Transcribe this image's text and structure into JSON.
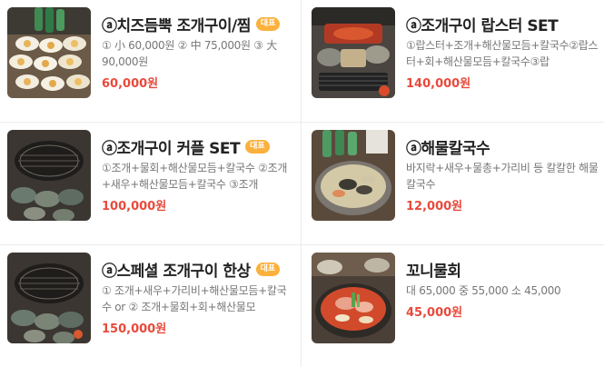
{
  "items": [
    {
      "title": "ⓐ치즈듬뿍 조개구이/찜",
      "badge": "대표",
      "desc": "① 小 60,000원 ② 中 75,000원 ③ 大 90,000원",
      "price": "60,000원",
      "thumb": "cheese-shellfish-photo"
    },
    {
      "title": "ⓐ조개구이 랍스터 SET",
      "badge": "",
      "desc": "①랍스터+조개+해산물모듬+칼국수②랍스터+회+해산물모듬+칼국수③랍",
      "price": "140,000원",
      "thumb": "lobster-set-photo"
    },
    {
      "title": "ⓐ조개구이 커플 SET",
      "badge": "대표",
      "desc": "①조개+물회+해산물모듬+칼국수 ②조개+새우+해산물모듬+칼국수 ③조개",
      "price": "100,000원",
      "thumb": "grill-couple-photo"
    },
    {
      "title": "ⓐ해물칼국수",
      "badge": "",
      "desc": "바지락+새우+물총+가리비 등 칼칼한 해물칼국수",
      "price": "12,000원",
      "thumb": "kalguksu-photo"
    },
    {
      "title": "ⓐ스페셜 조개구이 한상",
      "badge": "대표",
      "desc": "① 조개+새우+가리비+해산물모듬+칼국수 or ② 조개+물회+회+해산물모",
      "price": "150,000원",
      "thumb": "grill-special-photo"
    },
    {
      "title": "꼬니물회",
      "badge": "",
      "desc": "대 65,000 중 55,000 소 45,000",
      "price": "45,000원",
      "thumb": "mulhoe-photo"
    }
  ],
  "colors": {
    "price": "#e84a3c",
    "badge": "#fbb13c"
  }
}
